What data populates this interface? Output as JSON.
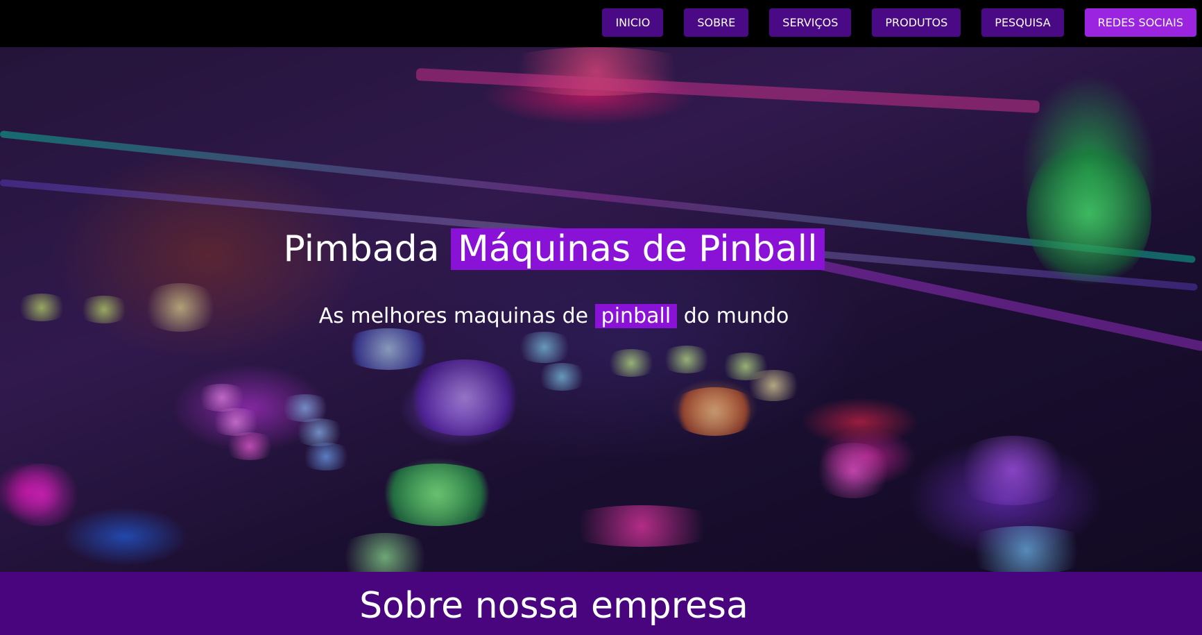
{
  "nav": {
    "items": [
      {
        "label": "INICIO"
      },
      {
        "label": "SOBRE"
      },
      {
        "label": "SERVIÇOS"
      },
      {
        "label": "PRODUTOS"
      },
      {
        "label": "PESQUISA"
      },
      {
        "label": "REDES SOCIAIS"
      }
    ]
  },
  "hero": {
    "title_prefix": "Pimbada",
    "title_highlight": "Máquinas de Pinball",
    "subtitle_prefix": "As melhores maquinas de",
    "subtitle_highlight": "pinball",
    "subtitle_suffix": "do mundo"
  },
  "about": {
    "title": "Sobre nossa empresa"
  },
  "colors": {
    "nav_button": "#4a0a85",
    "nav_button_active": "#9b24e0",
    "highlight": "#8a11d6",
    "about_bar": "#48057e"
  }
}
